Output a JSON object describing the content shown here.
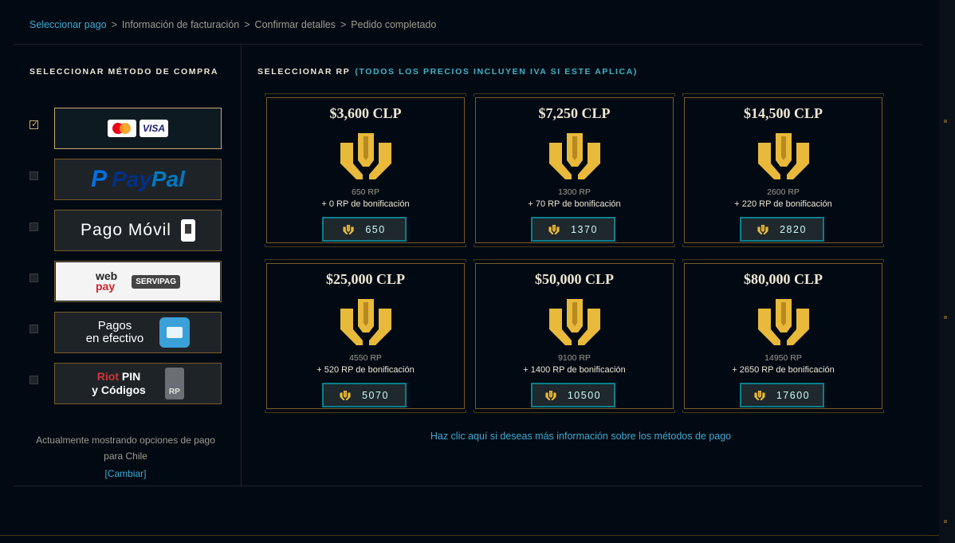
{
  "breadcrumb": {
    "steps": [
      "Seleccionar pago",
      "Información de facturación",
      "Confirmar detalles",
      "Pedido completado"
    ],
    "separator": ">"
  },
  "left": {
    "title": "SELECCIONAR MÉTODO DE COMPRA",
    "methods": {
      "cards": {
        "checked": true,
        "visa": "VISA"
      },
      "paypal": {
        "label_a": "Pay",
        "label_b": "Pal",
        "icon": "P"
      },
      "movil": {
        "label": "Pago Móvil"
      },
      "webpay": {
        "line1": "web",
        "line2": "pay",
        "servipag": "SERVIPAG"
      },
      "efectivo": {
        "line1": "Pagos",
        "line2": "en efectivo"
      },
      "riot": {
        "line1_a": "Riot",
        "line1_b": " PIN",
        "line2": "y Códigos",
        "card": "RP"
      }
    },
    "region_text": "Actualmente mostrando opciones de pago para Chile",
    "region_link": "[Cambiar]"
  },
  "right": {
    "title": "SELECCIONAR RP",
    "subtitle": "(TODOS LOS PRECIOS INCLUYEN IVA SI ESTE APLICA)",
    "packages": [
      {
        "price": "$3,600 CLP",
        "rp": "650 RP",
        "bonus": "+ 0 RP de bonificación",
        "total": "650"
      },
      {
        "price": "$7,250 CLP",
        "rp": "1300 RP",
        "bonus": "+ 70 RP de bonificación",
        "total": "1370"
      },
      {
        "price": "$14,500 CLP",
        "rp": "2600 RP",
        "bonus": "+ 220 RP de bonificación",
        "total": "2820"
      },
      {
        "price": "$25,000 CLP",
        "rp": "4550 RP",
        "bonus": "+ 520 RP de bonificación",
        "total": "5070"
      },
      {
        "price": "$50,000 CLP",
        "rp": "9100 RP",
        "bonus": "+ 1400 RP de bonificación",
        "total": "10500"
      },
      {
        "price": "$80,000 CLP",
        "rp": "14950 RP",
        "bonus": "+ 2650 RP de bonificación",
        "total": "17600"
      }
    ],
    "info_link": "Haz clic aquí si deseas más información sobre los métodos de pago"
  },
  "colors": {
    "gold": "#e8b93a",
    "teal": "#0a7e8c",
    "link": "#41a8d0"
  }
}
